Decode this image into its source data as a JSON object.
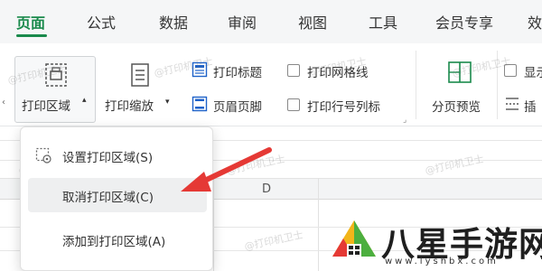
{
  "menubar": {
    "tabs": [
      {
        "label": "页面",
        "active": true
      },
      {
        "label": "公式"
      },
      {
        "label": "数据"
      },
      {
        "label": "审阅"
      },
      {
        "label": "视图"
      },
      {
        "label": "工具"
      },
      {
        "label": "会员专享"
      },
      {
        "label": "效"
      }
    ]
  },
  "ribbon": {
    "print_area": "打印区域",
    "print_scale": "打印缩放",
    "print_title": "打印标题",
    "header_footer": "页眉页脚",
    "print_gridlines": "打印网格线",
    "print_row_col_headers": "打印行号列标",
    "page_break_preview": "分页预览",
    "show_partial": "显示",
    "insert_partial": "插"
  },
  "dropdown": {
    "items": [
      {
        "label": "设置打印区域(S)"
      },
      {
        "label": "取消打印区域(C)",
        "highlighted": true
      },
      {
        "label": "添加到打印区域(A)"
      }
    ]
  },
  "sheet": {
    "columns": [
      "D"
    ]
  },
  "watermark": "@打印机卫士",
  "logo": {
    "title": "八星手游网",
    "url": "www.lyshbx.com"
  },
  "colors": {
    "accent": "#1a8a4c",
    "arrow": "#e53935"
  }
}
